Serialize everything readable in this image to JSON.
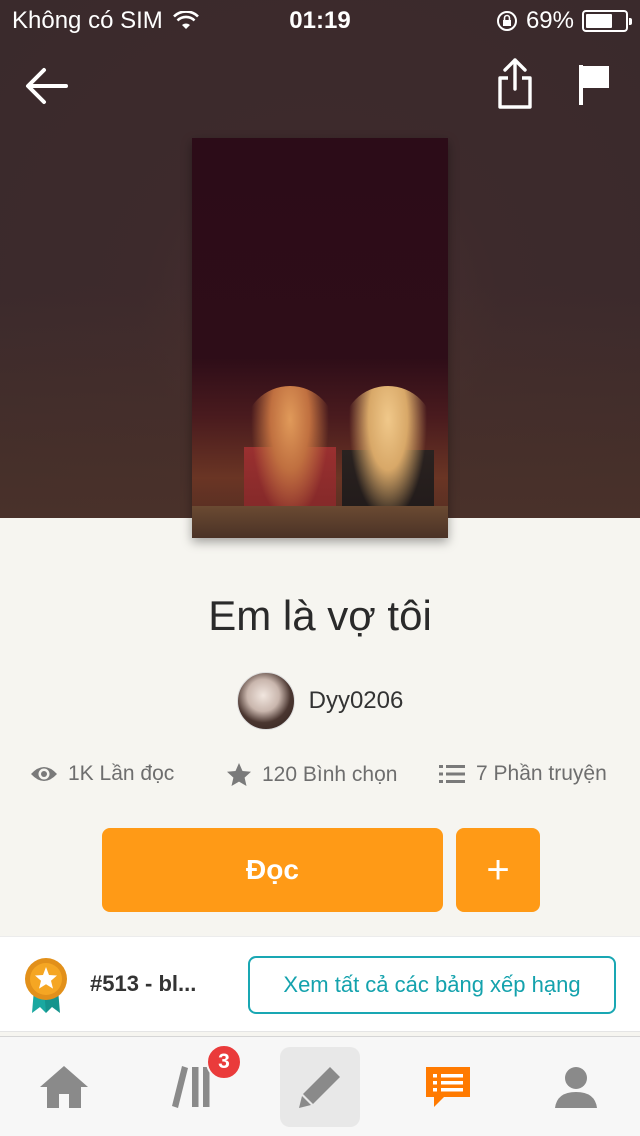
{
  "status_bar": {
    "carrier": "Không có SIM",
    "time": "01:19",
    "battery": "69%",
    "battery_level": 0.69,
    "wifi_icon": "wifi-icon",
    "lock_icon": "orientation-lock-icon"
  },
  "header": {
    "back_icon": "arrow-left-icon",
    "share_icon": "share-icon",
    "flag_icon": "flag-icon"
  },
  "story": {
    "title": "Em là vợ tôi",
    "author": "Dyy0206",
    "stats": {
      "reads": "1K Lần đọc",
      "votes": "120 Bình chọn",
      "parts": "7 Phần truyện"
    }
  },
  "actions": {
    "read_label": "Đọc",
    "add_label": "+"
  },
  "ranking": {
    "rank_text": "#513 - bl...",
    "view_all_label": "Xem tất cả các bảng xếp hạng"
  },
  "tabbar": {
    "library_badge": "3",
    "icons": [
      "home-icon",
      "library-icon",
      "pencil-icon",
      "messages-icon",
      "profile-icon"
    ]
  },
  "colors": {
    "accent_orange": "#ff9a16",
    "teal": "#14a2ad",
    "badge_red": "#ea3b3b"
  }
}
